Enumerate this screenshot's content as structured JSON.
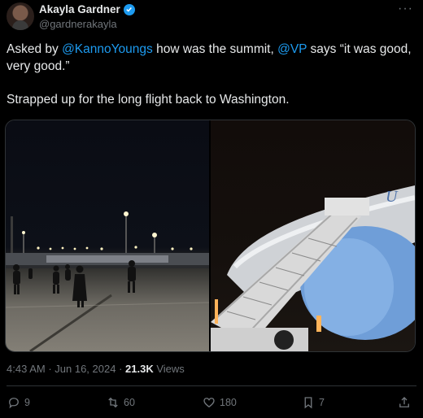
{
  "author": {
    "display_name": "Akayla Gardner",
    "handle": "@gardnerakayla",
    "verified": true
  },
  "more_menu_label": "···",
  "tweet": {
    "line1_prefix": "Asked by ",
    "mention1": "@KannoYoungs",
    "line1_middle": " how was the summit, ",
    "mention2": "@VP",
    "line1_suffix": " says “it was good, very good.”",
    "line2": "Strapped up for the long flight back to Washington."
  },
  "meta": {
    "time": "4:43 AM",
    "separator1": " · ",
    "date": "Jun 16, 2024",
    "separator2": " · ",
    "views_count": "21.3K",
    "views_label": " Views"
  },
  "actions": {
    "replies": "9",
    "reposts": "60",
    "likes": "180",
    "bookmarks": "7"
  },
  "plane_text": "U",
  "colors": {
    "accent": "#1d9bf0",
    "text": "#e7e9ea",
    "muted": "#71767b",
    "background": "#000000",
    "border": "#2f3336"
  }
}
